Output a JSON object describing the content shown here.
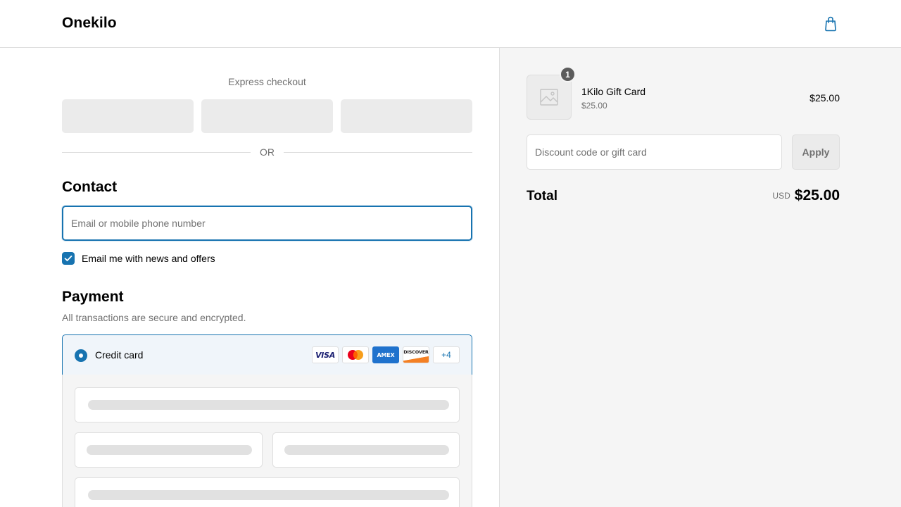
{
  "header": {
    "brand": "Onekilo",
    "cart_icon": "shopping-bag-icon"
  },
  "express": {
    "title": "Express checkout",
    "buttons": 3,
    "divider": "OR"
  },
  "contact": {
    "heading": "Contact",
    "email_placeholder": "Email or mobile phone number",
    "email_value": "",
    "marketing_label": "Email me with news and offers",
    "marketing_checked": true
  },
  "payment": {
    "heading": "Payment",
    "subtitle": "All transactions are secure and encrypted.",
    "method_label": "Credit card",
    "method_selected": true,
    "brands": [
      "VISA",
      "Mastercard",
      "AMEX",
      "DISCOVER"
    ],
    "more_brands": "+4"
  },
  "summary": {
    "items": [
      {
        "name": "1Kilo Gift Card",
        "subtitle": "$25.00",
        "price": "$25.00",
        "quantity": "1"
      }
    ],
    "discount_placeholder": "Discount code or gift card",
    "apply_label": "Apply",
    "total_label": "Total",
    "currency": "USD",
    "total": "$25.00"
  },
  "colors": {
    "accent": "#1773b0",
    "summary_bg": "#f5f5f5",
    "muted_text": "#707070",
    "border": "#dedede"
  }
}
